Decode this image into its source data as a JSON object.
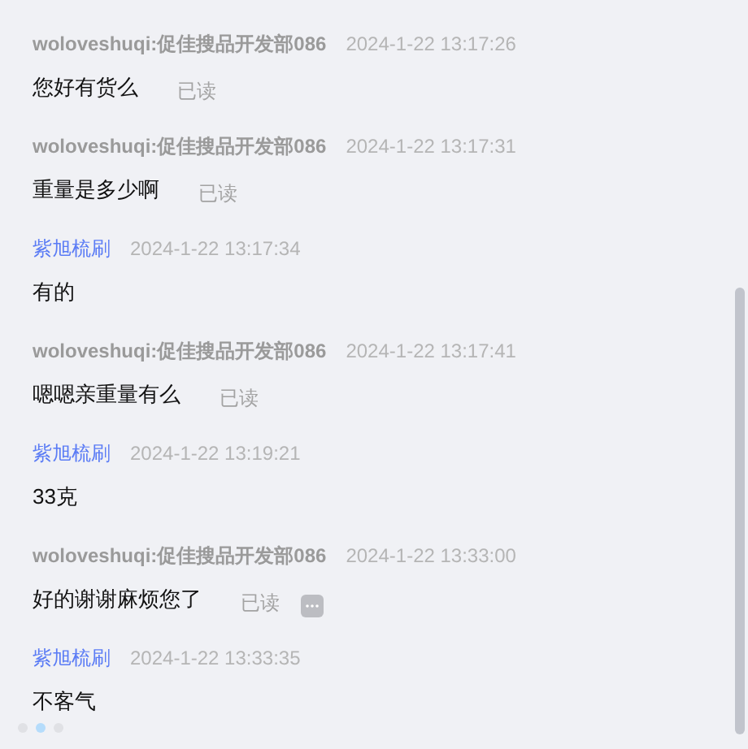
{
  "messages": [
    {
      "kind": "customer",
      "sender": "woloveshuqi:促佳搜品开发部086",
      "time": "2024-1-22 13:17:26",
      "text": "您好有货么",
      "read_status": "已读",
      "more_button": false
    },
    {
      "kind": "customer",
      "sender": "woloveshuqi:促佳搜品开发部086",
      "time": "2024-1-22 13:17:31",
      "text": "重量是多少啊",
      "read_status": "已读",
      "more_button": false
    },
    {
      "kind": "staff",
      "sender": "紫旭梳刷",
      "time": "2024-1-22 13:17:34",
      "text": "有的",
      "more_button": false
    },
    {
      "kind": "customer",
      "sender": "woloveshuqi:促佳搜品开发部086",
      "time": "2024-1-22 13:17:41",
      "text": "嗯嗯亲重量有么",
      "read_status": "已读",
      "more_button": false
    },
    {
      "kind": "staff",
      "sender": "紫旭梳刷",
      "time": "2024-1-22 13:19:21",
      "text": "33克",
      "more_button": false
    },
    {
      "kind": "customer",
      "sender": "woloveshuqi:促佳搜品开发部086",
      "time": "2024-1-22 13:33:00",
      "text": "好的谢谢麻烦您了",
      "read_status": "已读",
      "more_button": true
    },
    {
      "kind": "staff",
      "sender": "紫旭梳刷",
      "time": "2024-1-22 13:33:35",
      "text": "不客气",
      "more_button": false
    }
  ]
}
